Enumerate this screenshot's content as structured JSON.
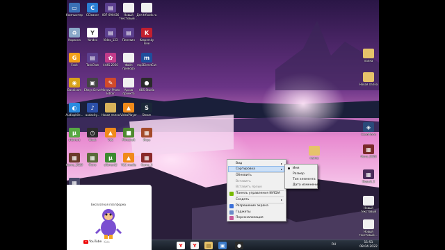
{
  "desktop_left": [
    {
      "label": "Компьютер",
      "icon": "computer-icon",
      "color": "#3a6fb5",
      "glyph": "▭"
    },
    {
      "label": "CCleaner",
      "icon": "ccleaner-icon",
      "color": "#2a7fd4",
      "glyph": "C"
    },
    {
      "label": "007-090436",
      "icon": "video-file-icon",
      "color": "#5b3f8e",
      "glyph": "▤"
    },
    {
      "label": "Новый текстовый ...",
      "icon": "text-file-icon",
      "color": "#f0f0f0",
      "glyph": ""
    },
    {
      "label": "Для trfoods.ru",
      "icon": "text-file-icon",
      "color": "#f0f0f0",
      "glyph": ""
    },
    {
      "label": "Корзина",
      "icon": "recycle-bin-icon",
      "color": "#8aa8c8",
      "glyph": "♻"
    },
    {
      "label": "Yandex",
      "icon": "yandex-browser-icon",
      "color": "#ffffff",
      "glyph": "Y"
    },
    {
      "label": "Video_123",
      "icon": "video-file-icon",
      "color": "#5b3f8e",
      "glyph": "▤"
    },
    {
      "label": "Пингвин",
      "icon": "video-file-icon",
      "color": "#5b3f8e",
      "glyph": "▤"
    },
    {
      "label": "Kaspersky Free",
      "icon": "kaspersky-icon",
      "color": "#c21f2f",
      "glyph": "K"
    },
    {
      "label": "Foxit",
      "icon": "foxit-icon",
      "color": "#f2a01b",
      "glyph": "G"
    },
    {
      "label": "TaskChat",
      "icon": "video-file-icon",
      "color": "#5b3f8e",
      "glyph": "▤"
    },
    {
      "label": "4445.2020",
      "icon": "image-file-icon",
      "color": "#c23b8a",
      "glyph": "✿"
    },
    {
      "label": "Файл привода",
      "icon": "text-file-icon",
      "color": "#f0f0f0",
      "glyph": ""
    },
    {
      "label": "mp3DirectCut",
      "icon": "mp3directcut-icon",
      "color": "#1f4e9c",
      "glyph": "m"
    },
    {
      "label": "Bandicam",
      "icon": "bandicam-icon",
      "color": "#d8a21a",
      "glyph": "◉"
    },
    {
      "label": "Ehays Drive",
      "icon": "app-icon",
      "color": "#444",
      "glyph": "▣"
    },
    {
      "label": "Movavi Photo Editor",
      "icon": "photo-editor-icon",
      "color": "#d14a2a",
      "glyph": "✎"
    },
    {
      "label": "Архив проекта",
      "icon": "text-file-icon",
      "color": "#f0f0f0",
      "glyph": ""
    },
    {
      "label": "OBS Studio",
      "icon": "obs-icon",
      "color": "#2a2a2a",
      "glyph": "●"
    },
    {
      "label": "Audiophile...",
      "icon": "globe-icon",
      "color": "#2a8be0",
      "glyph": "◐"
    },
    {
      "label": "audacity...",
      "icon": "audacity-icon",
      "color": "#2b4fa8",
      "glyph": "♪"
    },
    {
      "label": "Новая папка",
      "icon": "folder-icon",
      "color": "#d8b25a",
      "glyph": ""
    },
    {
      "label": "VideoPlayer",
      "icon": "vlc-icon",
      "color": "#f08a1a",
      "glyph": "▲"
    },
    {
      "label": "Steam",
      "icon": "steam-icon",
      "color": "#1b2838",
      "glyph": "S"
    },
    {
      "label": "uTorrent",
      "icon": "utorrent-icon",
      "color": "#57a843",
      "glyph": "µ"
    },
    {
      "label": "Clock",
      "icon": "clock-icon",
      "color": "#2b2b2b",
      "glyph": "◷"
    },
    {
      "label": "VLC",
      "icon": "vlc-icon",
      "color": "#f08a1a",
      "glyph": "▲"
    },
    {
      "label": "Minecraft",
      "icon": "minecraft-icon",
      "color": "#4f8a2f",
      "glyph": "■"
    },
    {
      "label": "Игра",
      "icon": "game-icon",
      "color": "#a44a2a",
      "glyph": "▦"
    },
    {
      "label": "Game_2020",
      "icon": "game-icon",
      "color": "#6a3a2a",
      "glyph": "▦"
    },
    {
      "label": "Фото",
      "icon": "image-file-icon",
      "color": "#5a6a3a",
      "glyph": "▦"
    },
    {
      "label": "uTorrent2",
      "icon": "utorrent-icon",
      "color": "#3c8a2f",
      "glyph": "µ"
    },
    {
      "label": "VLC media",
      "icon": "vlc-icon",
      "color": "#f08a1a",
      "glyph": "▲"
    },
    {
      "label": "Game_3",
      "icon": "game-icon",
      "color": "#8a2a2a",
      "glyph": "▦"
    },
    {
      "label": "Photo_2",
      "icon": "image-file-icon",
      "color": "#4a4a6a",
      "glyph": "▦"
    }
  ],
  "desktop_right": [
    {
      "label": "папка",
      "icon": "folder-icon",
      "color": "#e6c36a",
      "glyph": ""
    },
    {
      "label": "Новая папка",
      "icon": "folder-icon",
      "color": "#e6c36a",
      "glyph": ""
    },
    {
      "label": "СнапФото",
      "icon": "app-icon",
      "color": "#2a4a7a",
      "glyph": "◈"
    },
    {
      "label": "Фото_2020",
      "icon": "game-icon",
      "color": "#7a2a2a",
      "glyph": "▦"
    },
    {
      "label": "Новый_2",
      "icon": "game-icon",
      "color": "#4a2a5a",
      "glyph": "▦"
    },
    {
      "label": "Новый текстовый",
      "icon": "text-file-icon",
      "color": "#f0f0f0",
      "glyph": ""
    },
    {
      "label": "Новый текстовый ...",
      "icon": "text-file-icon",
      "color": "#f0f0f0",
      "glyph": ""
    }
  ],
  "center_folder": {
    "label": "папка",
    "icon": "folder-icon",
    "color": "#e6c36a"
  },
  "context_menu": {
    "items": [
      {
        "label": "Вид",
        "has_sub": true,
        "dim": false
      },
      {
        "label": "Сортировка",
        "has_sub": true,
        "dim": false,
        "highlighted": true
      },
      {
        "label": "Обновить",
        "dim": false
      },
      {
        "label": "Вставить",
        "dim": true
      },
      {
        "label": "Вставить ярлык",
        "dim": true
      },
      {
        "label": "Панель управления NVIDIA",
        "dim": false
      },
      {
        "label": "Создать",
        "has_sub": true,
        "dim": false
      },
      {
        "label": "Разрешение экрана",
        "dim": false
      },
      {
        "label": "Гаджеты",
        "dim": false
      },
      {
        "label": "Персонализация",
        "dim": false
      }
    ],
    "submenu": [
      {
        "label": "Имя",
        "selected": true
      },
      {
        "label": "Размер"
      },
      {
        "label": "Тип элемента"
      },
      {
        "label": "Дата изменения"
      }
    ]
  },
  "taskbar": {
    "buttons": [
      {
        "name": "yandex-taskbar",
        "glyph": "Y",
        "color": "#ffffff",
        "fg": "#e00"
      },
      {
        "name": "yandex-browser-taskbar",
        "glyph": "Y",
        "color": "#f4f4f4",
        "fg": "#e00"
      },
      {
        "name": "explorer-taskbar",
        "glyph": "▤",
        "color": "#e6c36a",
        "fg": "#6a4a10"
      },
      {
        "name": "media-taskbar",
        "glyph": "▣",
        "color": "#3a7ac8",
        "fg": "#fff"
      },
      {
        "name": "obs-taskbar",
        "glyph": "●",
        "color": "#2a2a2a",
        "fg": "#fff"
      }
    ],
    "language": "RU",
    "time": "11:51",
    "date": "08.04.2022"
  },
  "panel": {
    "text": "Бесплатная платформа",
    "logo_text": "YouTube",
    "logo_sub": "Kids"
  }
}
